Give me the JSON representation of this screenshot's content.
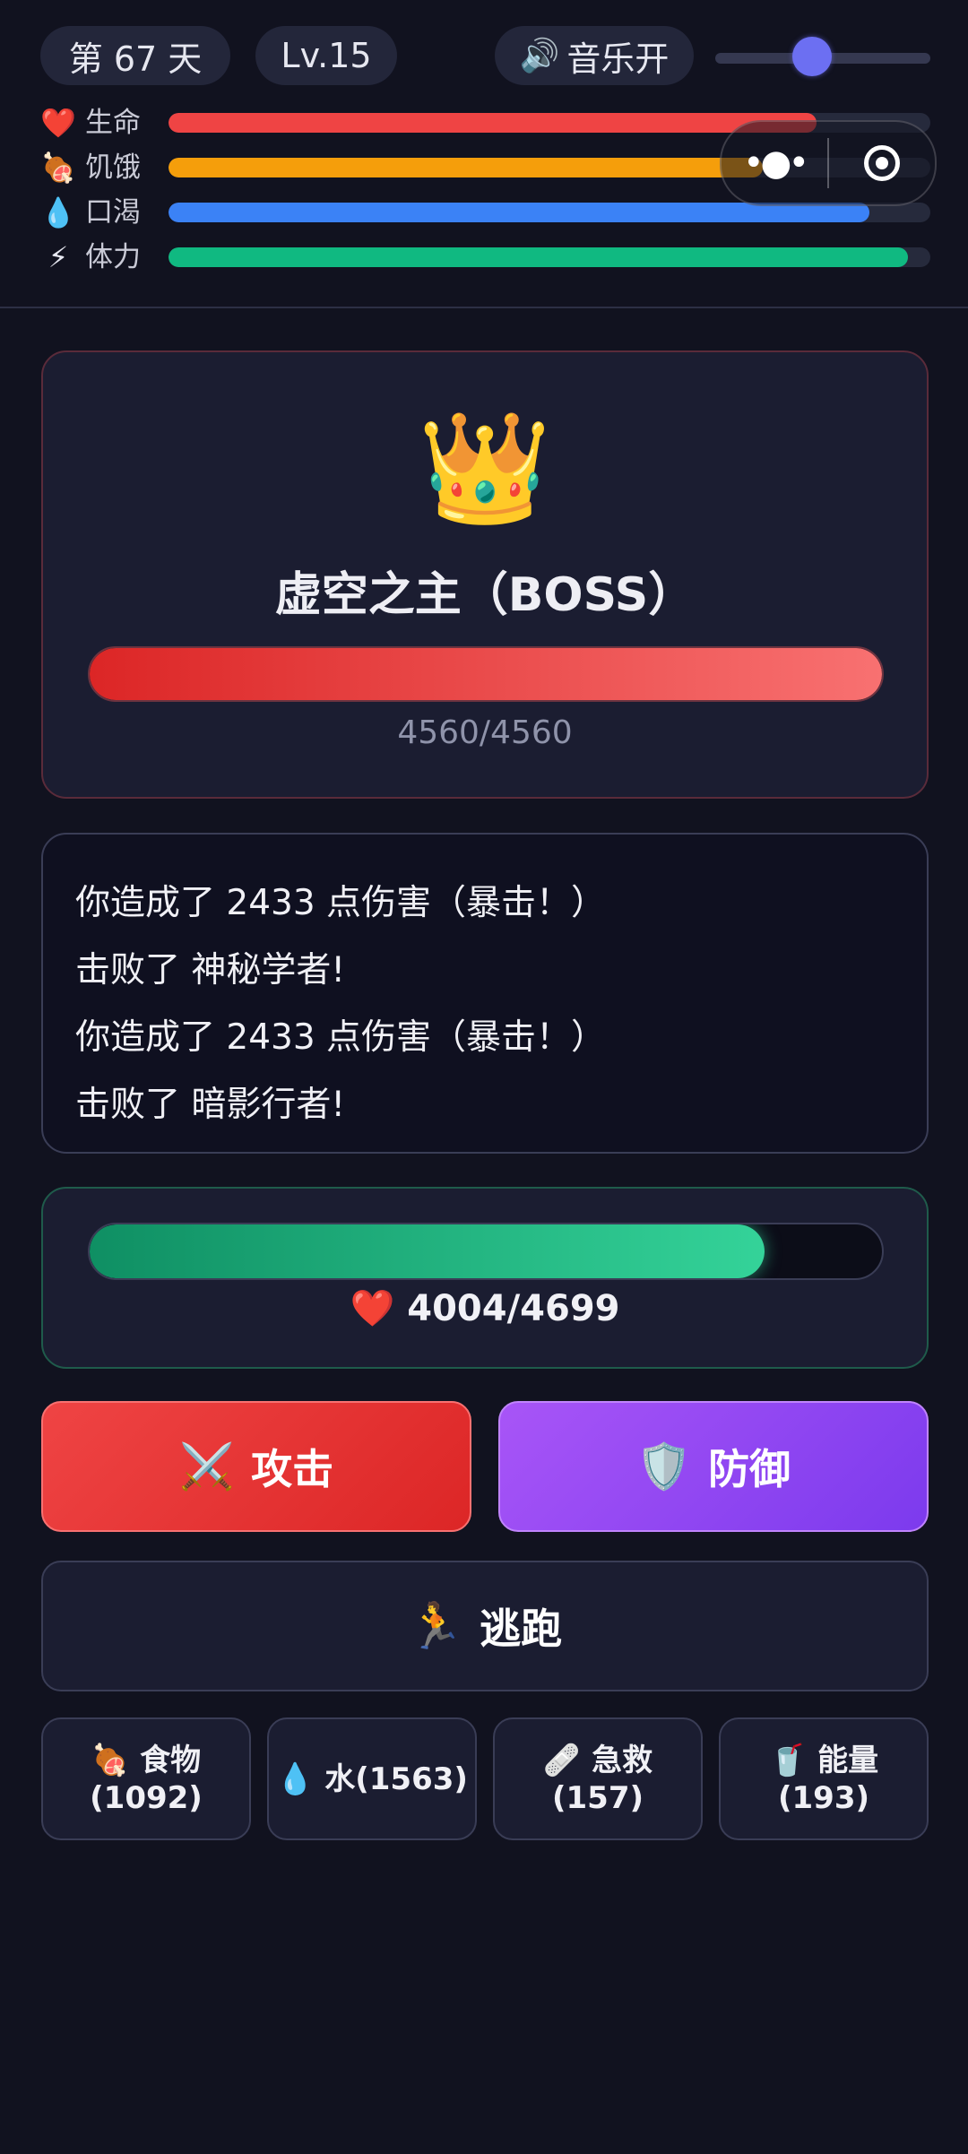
{
  "header": {
    "day_label": "第 67 天",
    "level_label": "Lv.15",
    "music_icon": "speaker-icon",
    "music_label": "音乐开",
    "volume_fraction": 0.45
  },
  "stats": [
    {
      "icon": "heart-icon",
      "glyph": "❤️",
      "label": "生命",
      "fraction": 0.85,
      "color": "#ef4444"
    },
    {
      "icon": "meat-icon",
      "glyph": "🍖",
      "label": "饥饿",
      "fraction": 0.78,
      "color": "#f59e0b"
    },
    {
      "icon": "droplet-icon",
      "glyph": "💧",
      "label": "口渴",
      "fraction": 0.92,
      "color": "#3b82f6"
    },
    {
      "icon": "lightning-icon",
      "glyph": "⚡",
      "label": "体力",
      "fraction": 0.97,
      "color": "#10b981"
    }
  ],
  "capsule": {
    "more": "•●•"
  },
  "boss": {
    "icon": "crown-icon",
    "glyph": "👑",
    "name": "虚空之主（BOSS）",
    "hp_text": "4560/4560",
    "hp_fraction": 1.0
  },
  "log": [
    "你造成了 2433 点伤害（暴击！）",
    "击败了 神秘学者!",
    "你造成了 2433 点伤害（暴击！）",
    "击败了 暗影行者!"
  ],
  "player": {
    "heart_glyph": "❤️",
    "hp_text": "4004/4699",
    "hp_fraction": 0.852
  },
  "actions": {
    "attack": {
      "glyph": "⚔️",
      "label": "攻击"
    },
    "defend": {
      "glyph": "🛡️",
      "label": "防御"
    },
    "flee": {
      "glyph": "🏃",
      "label": "逃跑"
    }
  },
  "items": [
    {
      "icon": "meat-icon",
      "glyph": "🍖",
      "line1": "食物",
      "line2": "(1092)"
    },
    {
      "icon": "droplet-icon",
      "glyph": "💧",
      "line1": "水(1563)",
      "line2": ""
    },
    {
      "icon": "bandage-icon",
      "glyph": "🩹",
      "line1": "急救",
      "line2": "(157)"
    },
    {
      "icon": "drink-icon",
      "glyph": "🥤",
      "line1": "能量",
      "line2": "(193)"
    }
  ]
}
